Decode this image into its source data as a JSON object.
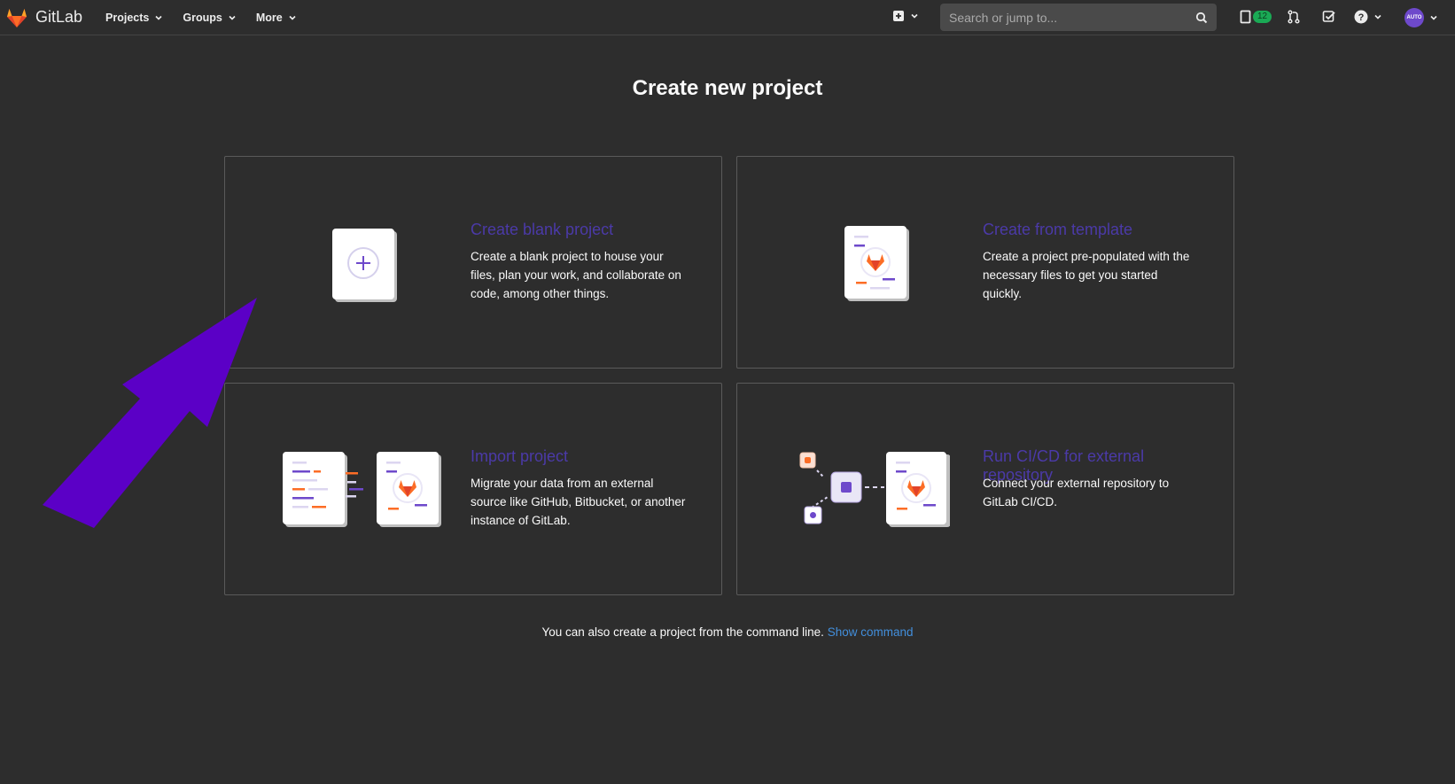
{
  "navbar": {
    "brand": "GitLab",
    "menu": [
      {
        "label": "Projects"
      },
      {
        "label": "Groups"
      },
      {
        "label": "More"
      }
    ],
    "search_placeholder": "Search or jump to...",
    "mr_count": "12",
    "avatar_text": "AUTO",
    "icons": [
      "plus-square-icon",
      "chevron-down-icon",
      "search-icon",
      "issues-icon",
      "merge-request-icon",
      "todo-icon",
      "help-icon",
      "avatar"
    ]
  },
  "page": {
    "title": "Create new project"
  },
  "cards": [
    {
      "title": "Create blank project",
      "desc": "Create a blank project to house your files, plan your work, and collaborate on code, among other things."
    },
    {
      "title": "Create from template",
      "desc": "Create a project pre-populated with the necessary files to get you started quickly."
    },
    {
      "title": "Import project",
      "desc": "Migrate your data from an external source like GitHub, Bitbucket, or another instance of GitLab."
    },
    {
      "title": "Run CI/CD for external repository",
      "desc": "Connect your external repository to GitLab CI/CD."
    }
  ],
  "footer": {
    "text": "You can also create a project from the command line.",
    "link": "Show command"
  },
  "colors": {
    "background": "#2d2d2d",
    "card_title": "#4b3aa8",
    "link": "#428fdc",
    "annotation_arrow": "#5b00c6",
    "gitlab_orange": "#fc6d26"
  }
}
